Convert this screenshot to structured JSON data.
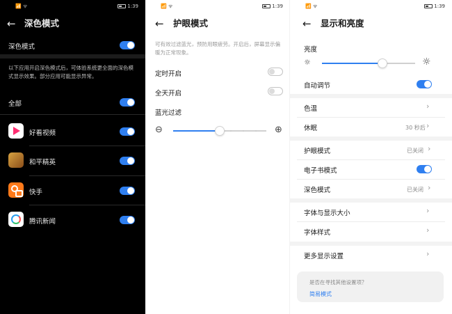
{
  "status": {
    "time": "1:39",
    "signal_icons": "📶 ᯤ"
  },
  "dark_mode": {
    "title": "深色模式",
    "main_toggle_label": "深色模式",
    "main_toggle_on": true,
    "description": "以下应用开启深色模式后，可体验系统更全面的深色模式显示效果。部分应用可能显示异常。",
    "all_label": "全部",
    "all_on": true,
    "apps": [
      {
        "name": "好看视频",
        "icon": "play-video-icon",
        "on": true
      },
      {
        "name": "和平精英",
        "icon": "game-icon",
        "on": true
      },
      {
        "name": "快手",
        "icon": "kuaishou-icon",
        "on": true
      },
      {
        "name": "腾讯新闻",
        "icon": "tencent-news-icon",
        "on": true
      }
    ]
  },
  "eye_comfort": {
    "title": "护眼模式",
    "description": "可有效过滤蓝光，预防用眼疲劳。开启后，屏幕显示偏暖为正常现象。",
    "scheduled_label": "定时开启",
    "scheduled_on": false,
    "all_day_label": "全天开启",
    "all_day_on": false,
    "filter_label": "蓝光过滤",
    "filter_level": 0.5,
    "minus_symbol": "⊖",
    "plus_symbol": "⊕"
  },
  "display": {
    "title": "显示和亮度",
    "brightness_label": "亮度",
    "brightness_level": 0.65,
    "auto_label": "自动调节",
    "auto_on": true,
    "color_temp_label": "色温",
    "sleep_label": "休眠",
    "sleep_value": "30 秒后",
    "eye_label": "护眼模式",
    "eye_value": "已关闭",
    "ebook_label": "电子书模式",
    "ebook_on": true,
    "dark_label": "深色模式",
    "dark_value": "已关闭",
    "font_size_label": "字体与显示大小",
    "font_style_label": "字体样式",
    "more_label": "更多显示设置",
    "suggest_question": "是否在寻找其他设置项？",
    "suggest_link": "简易模式"
  },
  "colors": {
    "accent": "#2f7ff0",
    "dark_bg": "#000000"
  }
}
